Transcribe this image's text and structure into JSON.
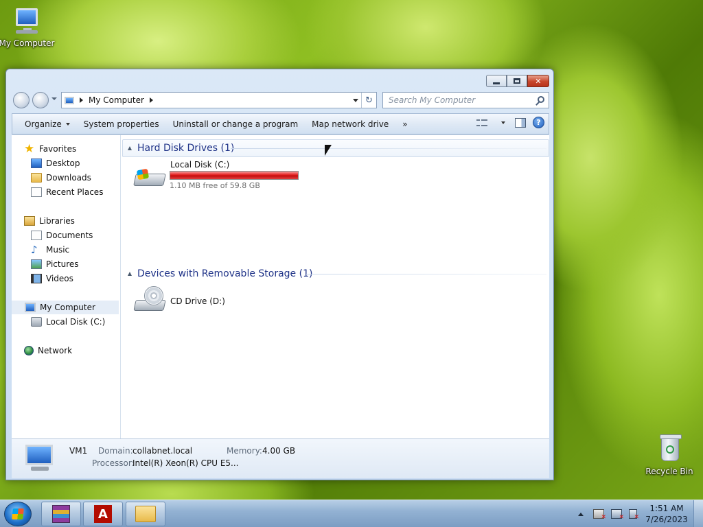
{
  "desktop": {
    "icons": [
      {
        "label": "My Computer",
        "icon": "computer-icon"
      },
      {
        "label": "Recycle Bin",
        "icon": "recycle-bin-icon"
      }
    ]
  },
  "window": {
    "caption": {
      "minimize": "minimize",
      "maximize": "maximize",
      "close": "✕"
    },
    "address": {
      "crumb": "My Computer",
      "refresh": "↻"
    },
    "search": {
      "placeholder": "Search My Computer"
    },
    "toolbar": {
      "organize": "Organize",
      "system_properties": "System properties",
      "uninstall": "Uninstall or change a program",
      "map_drive": "Map network drive",
      "more": "»",
      "help": "?"
    },
    "nav": {
      "favorites": "Favorites",
      "desktop": "Desktop",
      "downloads": "Downloads",
      "recent": "Recent Places",
      "libraries": "Libraries",
      "documents": "Documents",
      "music": "Music",
      "pictures": "Pictures",
      "videos": "Videos",
      "my_computer": "My Computer",
      "local_disk": "Local Disk (C:)",
      "network": "Network"
    },
    "groups": {
      "hdd": "Hard Disk Drives (1)",
      "removable": "Devices with Removable Storage (1)"
    },
    "drives": {
      "c": {
        "name": "Local Disk (C:)",
        "free_text": "1.10 MB free of 59.8 GB",
        "used_fraction": 0.99998
      },
      "d": {
        "name": "CD Drive (D:)"
      }
    },
    "details": {
      "name": "VM1",
      "domain_label": "Domain:",
      "domain": "collabnet.local",
      "memory_label": "Memory:",
      "memory": "4.00 GB",
      "processor_label": "Processor:",
      "processor": "Intel(R) Xeon(R) CPU E5..."
    }
  },
  "taskbar": {
    "apps": [
      "winrar-icon",
      "adobe-acrobat-icon",
      "windows-explorer-icon"
    ],
    "acrobat_glyph": "A",
    "clock": {
      "time": "1:51 AM",
      "date": "7/26/2023"
    }
  },
  "colors": {
    "drive_bar": "#e41f1f",
    "group_heading": "#1e3287"
  }
}
